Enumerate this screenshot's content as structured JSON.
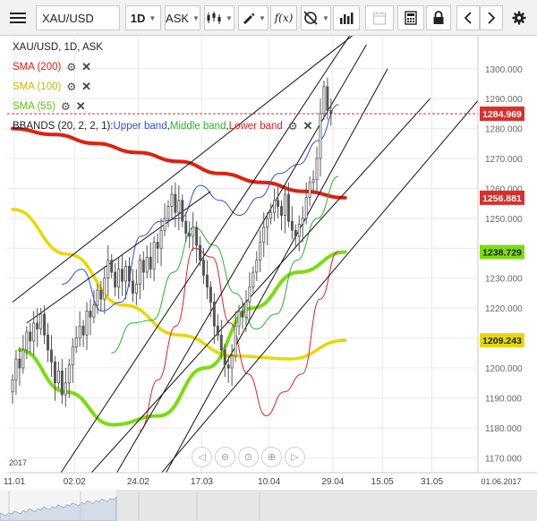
{
  "toolbar": {
    "menu_icon": "hamburger-menu-icon",
    "symbol_input": "XAU/USD",
    "period": "1D",
    "price_side": "ASK",
    "chart_type_icon": "candlestick-icon",
    "drawing_icon": "pencil-icon",
    "indicator_label": "f(x)",
    "crosshair_icon": "crosshair-icon",
    "volume_icon": "bar-volume-icon",
    "calendar_icon": "calendar-icon",
    "calculator_icon": "calculator-icon",
    "lock_icon": "lock-icon",
    "back_icon": "chevron-left-icon",
    "forward_icon": "chevron-right-icon",
    "settings_icon": "gear-icon"
  },
  "legend": {
    "title": "XAU/USD, 1D, ASK",
    "sma200": "SMA (200)",
    "sma100": "SMA (100)",
    "sma55": "SMA (55)",
    "bbands_prefix": "BBANDS (20, 2, 2, 1): ",
    "bb_upper": "Upper band",
    "bb_sep1": ", ",
    "bb_middle": "Middle band",
    "bb_sep2": ", ",
    "bb_lower": "Lower band",
    "gear_icon": "gear-icon",
    "close_icon": "close-icon"
  },
  "zoom_controls": [
    "chevron-left-icon",
    "zoom-out-icon",
    "reset-icon",
    "zoom-in-icon",
    "chevron-right-icon"
  ],
  "colors": {
    "price_tag": "#d9302c",
    "sma200": "#e02010",
    "sma100": "#e8d800",
    "sma55": "#7cdc10",
    "bb_upper": "#3050d8",
    "bb_middle": "#28b428",
    "bb_lower": "#e02020",
    "candle": "#555555"
  },
  "chart_data": {
    "type": "candlestick",
    "symbol": "XAU/USD",
    "timeframe": "1D",
    "price_side": "ASK",
    "x_ticks": [
      "11.01",
      "02.02",
      "24.02",
      "17.03",
      "10.04",
      "29.04",
      "15.05",
      "31.05",
      "01.06.2017"
    ],
    "x_year_label": "2017",
    "y_ticks": [
      1170,
      1180,
      1190,
      1200,
      1210,
      1220,
      1230,
      1240,
      1250,
      1260,
      1270,
      1280,
      1290,
      1300
    ],
    "y_tick_labels": [
      "1170.000",
      "1180.000",
      "1190.000",
      "1200.000",
      "1210.000",
      "1220.000",
      "1230.000",
      "1240.000",
      "1250.000",
      "1260.000",
      "1270.000",
      "1280.000",
      "1290.000",
      "1300.000"
    ],
    "ylim": [
      1165,
      1311
    ],
    "tags": [
      {
        "label": "1284.969",
        "value": 1284.969,
        "kind": "price"
      },
      {
        "label": "1256.881",
        "value": 1256.881,
        "kind": "sma200"
      },
      {
        "label": "1238.729",
        "value": 1238.729,
        "kind": "sma55"
      },
      {
        "label": "1209.243",
        "value": 1209.243,
        "kind": "sma100"
      }
    ],
    "closes": [
      1196,
      1203,
      1200,
      1206,
      1212,
      1209,
      1215,
      1213,
      1218,
      1211,
      1206,
      1202,
      1195,
      1199,
      1191,
      1195,
      1201,
      1207,
      1210,
      1214,
      1211,
      1219,
      1217,
      1221,
      1226,
      1223,
      1230,
      1236,
      1232,
      1227,
      1233,
      1229,
      1234,
      1229,
      1225,
      1228,
      1236,
      1232,
      1237,
      1233,
      1242,
      1240,
      1246,
      1250,
      1254,
      1258,
      1252,
      1256,
      1249,
      1245,
      1244,
      1247,
      1241,
      1236,
      1231,
      1227,
      1222,
      1214,
      1211,
      1206,
      1201,
      1200,
      1204,
      1214,
      1219,
      1217,
      1222,
      1227,
      1232,
      1236,
      1242,
      1247,
      1250,
      1252,
      1256,
      1254,
      1251,
      1258,
      1249,
      1246,
      1244,
      1248,
      1250,
      1257,
      1262,
      1263,
      1270,
      1285,
      1294,
      1286,
      1284.969
    ],
    "sma200": [
      1280,
      1278,
      1275,
      1272,
      1269,
      1265,
      1262,
      1259,
      1256.881
    ],
    "sma100": [
      1253,
      1238,
      1221,
      1211,
      1204,
      1203,
      1209.243
    ],
    "sma55": [
      1206,
      1192,
      1181,
      1184,
      1200,
      1220,
      1232,
      1238.729
    ],
    "bb_upper": [
      1228,
      1233,
      1219,
      1222,
      1244,
      1249,
      1250,
      1261,
      1256,
      1251,
      1257,
      1265,
      1268,
      1276,
      1288
    ],
    "bb_middle": [
      1205,
      1215,
      1216,
      1232,
      1247,
      1241,
      1225,
      1213,
      1218,
      1236,
      1250,
      1264
    ],
    "bb_lower": [
      1179,
      1196,
      1214,
      1240,
      1237,
      1215,
      1198,
      1184,
      1192,
      1198,
      1223,
      1239
    ],
    "trendlines": [
      {
        "from": [
          0,
          1222
        ],
        "to": [
          96,
          1311
        ]
      },
      {
        "from": [
          4,
          1215
        ],
        "to": [
          56,
          1259
        ]
      },
      {
        "from": [
          12,
          1162
        ],
        "to": [
          98,
          1316
        ]
      },
      {
        "from": [
          28,
          1162
        ],
        "to": [
          100,
          1308
        ]
      },
      {
        "from": [
          42,
          1162
        ],
        "to": [
          106,
          1300
        ]
      },
      {
        "from": [
          20,
          1162
        ],
        "to": [
          118,
          1290
        ]
      },
      {
        "from": [
          40,
          1162
        ],
        "to": [
          132,
          1290
        ]
      }
    ]
  }
}
